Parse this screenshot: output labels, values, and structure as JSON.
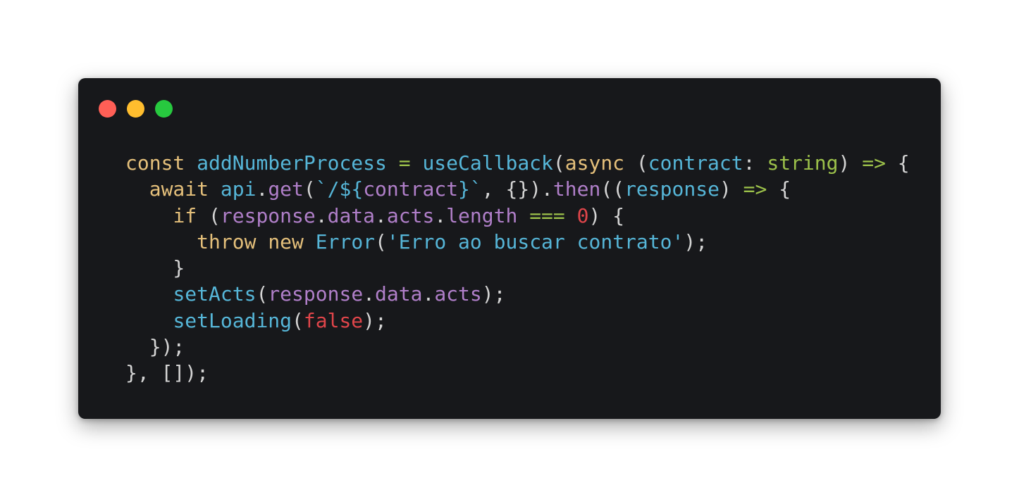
{
  "window": {
    "controls": [
      "close",
      "minimize",
      "maximize"
    ],
    "colors": {
      "background": "#17181b",
      "close": "#ff5f56",
      "minimize": "#ffbd2e",
      "maximize": "#27c93f"
    }
  },
  "code": {
    "language": "typescript",
    "palette": {
      "keyword": "#e5c07b",
      "function": "#56b6d8",
      "property": "#b07fc9",
      "operator": "#9cc14a",
      "type": "#9cc14a",
      "string": "#56b6d8",
      "number": "#e0454a",
      "literal": "#e0454a",
      "punct": "#d4d4d4"
    },
    "lines": [
      [
        {
          "t": "const",
          "c": "keyword"
        },
        {
          "t": " ",
          "c": "punct"
        },
        {
          "t": "addNumberProcess",
          "c": "function"
        },
        {
          "t": " ",
          "c": "punct"
        },
        {
          "t": "=",
          "c": "operator"
        },
        {
          "t": " ",
          "c": "punct"
        },
        {
          "t": "useCallback",
          "c": "function"
        },
        {
          "t": "(",
          "c": "punct"
        },
        {
          "t": "async",
          "c": "keyword"
        },
        {
          "t": " (",
          "c": "punct"
        },
        {
          "t": "contract",
          "c": "function"
        },
        {
          "t": ": ",
          "c": "punct"
        },
        {
          "t": "string",
          "c": "type"
        },
        {
          "t": ") ",
          "c": "punct"
        },
        {
          "t": "=>",
          "c": "operator"
        },
        {
          "t": " {",
          "c": "punct"
        }
      ],
      [
        {
          "t": "  ",
          "c": "punct"
        },
        {
          "t": "await",
          "c": "keyword"
        },
        {
          "t": " ",
          "c": "punct"
        },
        {
          "t": "api",
          "c": "function"
        },
        {
          "t": ".",
          "c": "punct"
        },
        {
          "t": "get",
          "c": "property"
        },
        {
          "t": "(",
          "c": "punct"
        },
        {
          "t": "`/${",
          "c": "string"
        },
        {
          "t": "contract",
          "c": "property"
        },
        {
          "t": "}`",
          "c": "string"
        },
        {
          "t": ", {}).",
          "c": "punct"
        },
        {
          "t": "then",
          "c": "property"
        },
        {
          "t": "((",
          "c": "punct"
        },
        {
          "t": "response",
          "c": "function"
        },
        {
          "t": ") ",
          "c": "punct"
        },
        {
          "t": "=>",
          "c": "operator"
        },
        {
          "t": " {",
          "c": "punct"
        }
      ],
      [
        {
          "t": "    ",
          "c": "punct"
        },
        {
          "t": "if",
          "c": "keyword"
        },
        {
          "t": " (",
          "c": "punct"
        },
        {
          "t": "response",
          "c": "property"
        },
        {
          "t": ".",
          "c": "punct"
        },
        {
          "t": "data",
          "c": "property"
        },
        {
          "t": ".",
          "c": "punct"
        },
        {
          "t": "acts",
          "c": "property"
        },
        {
          "t": ".",
          "c": "punct"
        },
        {
          "t": "length",
          "c": "property"
        },
        {
          "t": " ",
          "c": "punct"
        },
        {
          "t": "===",
          "c": "operator"
        },
        {
          "t": " ",
          "c": "punct"
        },
        {
          "t": "0",
          "c": "number"
        },
        {
          "t": ") {",
          "c": "punct"
        }
      ],
      [
        {
          "t": "      ",
          "c": "punct"
        },
        {
          "t": "throw",
          "c": "keyword"
        },
        {
          "t": " ",
          "c": "punct"
        },
        {
          "t": "new",
          "c": "keyword"
        },
        {
          "t": " ",
          "c": "punct"
        },
        {
          "t": "Error",
          "c": "function"
        },
        {
          "t": "(",
          "c": "punct"
        },
        {
          "t": "'Erro ao buscar contrato'",
          "c": "string"
        },
        {
          "t": ");",
          "c": "punct"
        }
      ],
      [
        {
          "t": "    }",
          "c": "punct"
        }
      ],
      [
        {
          "t": "    ",
          "c": "punct"
        },
        {
          "t": "setActs",
          "c": "function"
        },
        {
          "t": "(",
          "c": "punct"
        },
        {
          "t": "response",
          "c": "property"
        },
        {
          "t": ".",
          "c": "punct"
        },
        {
          "t": "data",
          "c": "property"
        },
        {
          "t": ".",
          "c": "punct"
        },
        {
          "t": "acts",
          "c": "property"
        },
        {
          "t": ");",
          "c": "punct"
        }
      ],
      [
        {
          "t": "    ",
          "c": "punct"
        },
        {
          "t": "setLoading",
          "c": "function"
        },
        {
          "t": "(",
          "c": "punct"
        },
        {
          "t": "false",
          "c": "literal"
        },
        {
          "t": ");",
          "c": "punct"
        }
      ],
      [
        {
          "t": "  });",
          "c": "punct"
        }
      ],
      [
        {
          "t": "}, []);",
          "c": "punct"
        }
      ]
    ]
  }
}
